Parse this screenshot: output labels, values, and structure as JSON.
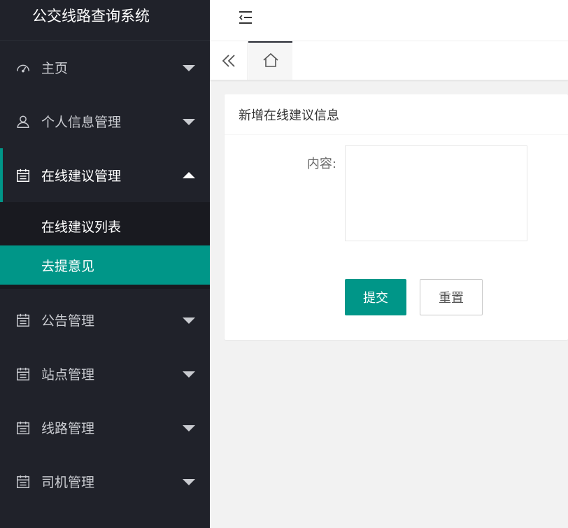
{
  "app": {
    "title": "公交线路查询系统"
  },
  "sidebar": {
    "items": [
      {
        "label": "主页",
        "icon": "dashboard-icon",
        "state": "collapsed"
      },
      {
        "label": "个人信息管理",
        "icon": "user-icon",
        "state": "collapsed"
      },
      {
        "label": "在线建议管理",
        "icon": "calendar-icon",
        "state": "expanded",
        "children": [
          {
            "label": "在线建议列表",
            "active": false
          },
          {
            "label": "去提意见",
            "active": true
          }
        ]
      },
      {
        "label": "公告管理",
        "icon": "calendar-icon",
        "state": "collapsed"
      },
      {
        "label": "站点管理",
        "icon": "calendar-icon",
        "state": "collapsed"
      },
      {
        "label": "线路管理",
        "icon": "calendar-icon",
        "state": "collapsed"
      },
      {
        "label": "司机管理",
        "icon": "calendar-icon",
        "state": "collapsed"
      }
    ]
  },
  "header": {
    "menu_toggle_icon": "menu-fold-icon"
  },
  "tabs": {
    "prev_icon": "double-chevron-left-icon",
    "home_icon": "home-icon"
  },
  "card": {
    "title": "新增在线建议信息",
    "fields": {
      "content_label": "内容:",
      "content_value": ""
    },
    "buttons": {
      "submit": "提交",
      "reset": "重置"
    }
  },
  "colors": {
    "accent": "#009688",
    "sidebar_bg": "#20222a",
    "submenu_bg": "#191a20"
  }
}
